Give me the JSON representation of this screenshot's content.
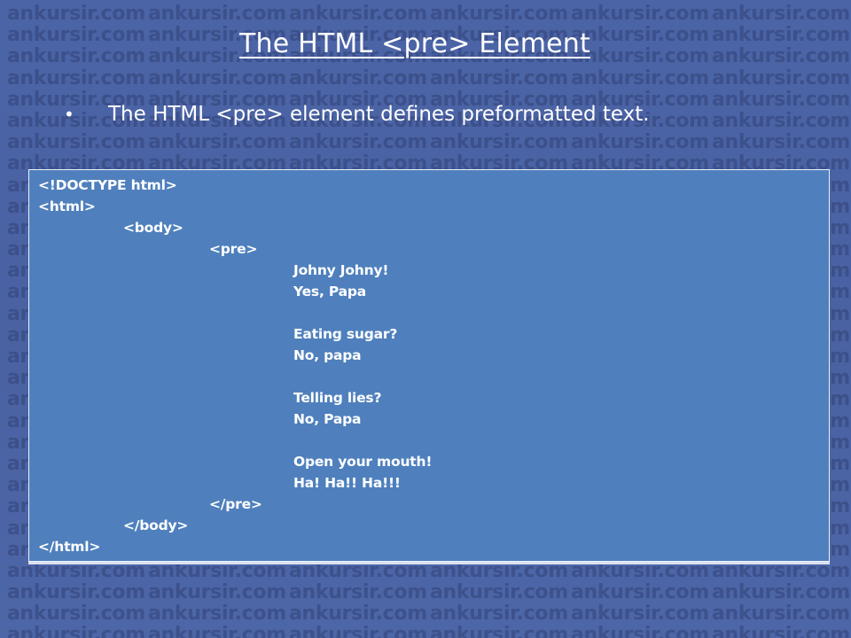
{
  "watermark": {
    "text": "ankursir.com"
  },
  "slide": {
    "title": "The HTML <pre> Element",
    "bullet_symbol": "•",
    "bullet_text": "The HTML <pre> element defines preformatted text."
  },
  "code_lines": [
    "<!DOCTYPE html>",
    "<html>",
    "<body>",
    "<pre>",
    "Johny Johny!",
    "Yes, Papa",
    "Eating sugar?",
    "No, papa",
    "Telling lies?",
    "No, Papa",
    "Open your mouth!",
    "Ha! Ha!! Ha!!!",
    "</pre>",
    "</body>",
    "</html>"
  ]
}
